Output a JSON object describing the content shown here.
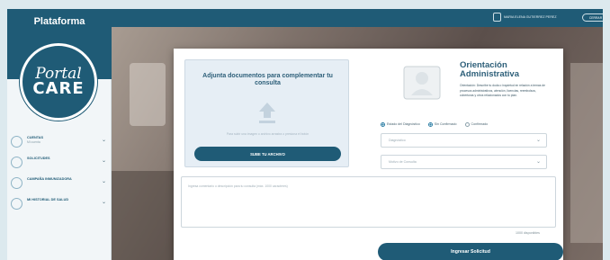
{
  "app": {
    "brand": "Plataforma",
    "logo": {
      "line1": "Portal",
      "line2": "CARE"
    }
  },
  "topbar": {
    "user_name": "MARIA ELENA GUTIERREZ PEREZ",
    "logout_label": "CERRAR"
  },
  "sidebar": {
    "items": [
      {
        "label": "CUENTAS",
        "sub": "Mi cuenta",
        "icon": "user-icon"
      },
      {
        "label": "SOLICITUDES",
        "sub": "",
        "icon": "document-icon"
      },
      {
        "label": "CAMPAÑA INMUNIZADORA",
        "sub": "",
        "icon": "syringe-icon"
      },
      {
        "label": "MI HISTORIAL DE SALUD",
        "sub": "",
        "icon": "clipboard-icon"
      }
    ]
  },
  "upload": {
    "title": "Adjunta documentos para complementar tu consulta",
    "hint": "Para subir una imagen o archivo arrastra o presiona el botón",
    "button_label": "SUBE TU ARCHIVO"
  },
  "info": {
    "title": "Orientación Administrativa",
    "text": "Orientación: Describe tu duda o inquietud en relación a temas de procesos administrativos, atención, licencias, reembolsos, coberturas y otros relacionados con tu plan."
  },
  "diagnosis_radios": {
    "options": [
      {
        "label": "Estado del Diagnóstico",
        "selected": true
      },
      {
        "label": "Sin Confirmado",
        "selected": true
      },
      {
        "label": "Confirmado",
        "selected": false
      }
    ]
  },
  "selects": {
    "diagnosis_placeholder": "Diagnóstico",
    "reason_placeholder": "Motivo de Consulta"
  },
  "comment": {
    "placeholder": "Ingresa comentario o descripción para tu consulta (máx. 1000 caracteres)",
    "counter": "1000 disponibles"
  },
  "submit": {
    "label": "Ingresar Solicitud"
  },
  "colors": {
    "primary": "#1f5b76",
    "accent": "#2b7da4",
    "panel": "#e6eef5"
  }
}
